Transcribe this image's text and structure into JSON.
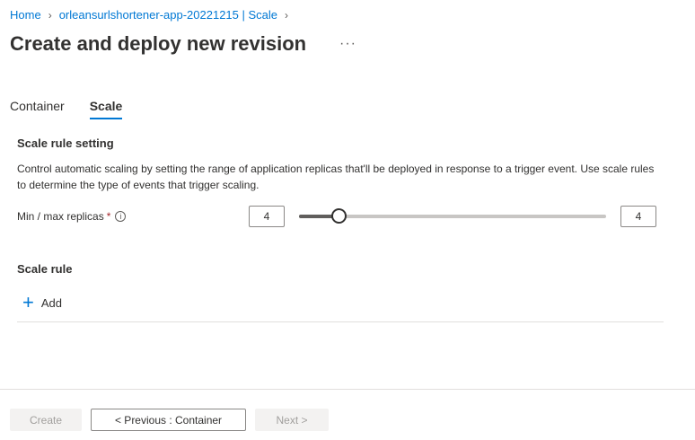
{
  "breadcrumb": {
    "home": "Home",
    "app": "orleansurlshortener-app-20221215 | Scale"
  },
  "page": {
    "title": "Create and deploy new revision",
    "more": "···"
  },
  "tabs": [
    {
      "label": "Container",
      "active": false
    },
    {
      "label": "Scale",
      "active": true
    }
  ],
  "scale_setting": {
    "title": "Scale rule setting",
    "description": "Control automatic scaling by setting the range of application replicas that'll be deployed in response to a trigger event. Use scale rules to determine the type of events that trigger scaling.",
    "replicas_label": "Min / max replicas",
    "required_mark": "*",
    "info_glyph": "i",
    "min_value": "4",
    "max_value": "4",
    "slider_level": 0.13
  },
  "scale_rule": {
    "title": "Scale rule",
    "add_label": "Add"
  },
  "footer": {
    "create_label": "Create",
    "previous_label": "< Previous : Container",
    "next_label": "Next >"
  },
  "colors": {
    "accent": "#0078d4",
    "required": "#a4262c"
  }
}
